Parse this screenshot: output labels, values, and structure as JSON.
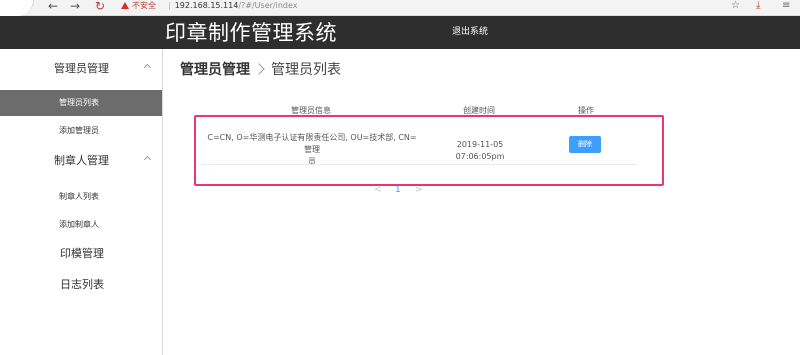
{
  "browser": {
    "security_label": "不安全",
    "url_host": "192.168.15.114",
    "url_path": "/?#/User/index"
  },
  "header": {
    "title": "印章制作管理系统",
    "logout_label": "退出系统"
  },
  "sidebar": {
    "groups": [
      {
        "label": "管理员管理",
        "items": [
          {
            "label": "管理员列表",
            "active": true
          },
          {
            "label": "添加管理员",
            "active": false
          }
        ]
      },
      {
        "label": "制章人管理",
        "items": [
          {
            "label": "制章人列表",
            "active": false
          },
          {
            "label": "添加制章人",
            "active": false
          }
        ]
      }
    ],
    "top_items": [
      {
        "label": "印模管理"
      },
      {
        "label": "日志列表"
      }
    ]
  },
  "breadcrumb": {
    "parent": "管理员管理",
    "current": "管理员列表"
  },
  "table": {
    "columns": [
      "管理员信息",
      "创建时间",
      "操作"
    ],
    "rows": [
      {
        "info_line1": "C=CN, O=华测电子认证有限责任公司, OU=技术部, CN=管理",
        "info_line2": "员",
        "created": "2019-11-05 07:06:05pm",
        "action": "删除"
      }
    ]
  },
  "pagination": {
    "prev": "<",
    "current_page": "1",
    "next": ">"
  },
  "colors": {
    "header_bg": "#2e2e2e",
    "active_item_bg": "#6c6c6c",
    "primary": "#409eff",
    "highlight_border": "#e8366e"
  }
}
